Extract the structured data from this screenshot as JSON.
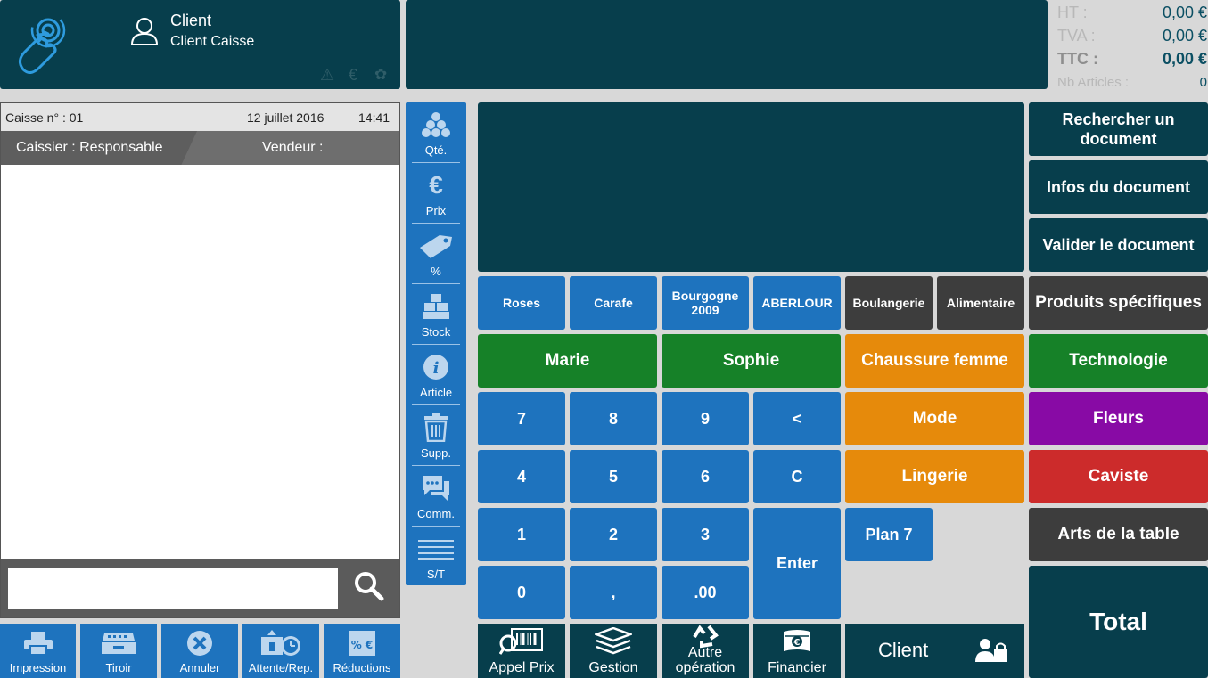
{
  "header": {
    "client_title": "Client",
    "client_name": "Client Caisse"
  },
  "totals": {
    "ht_label": "HT :",
    "ht_value": "0,00 €",
    "tva_label": "TVA  :",
    "tva_value": "0,00 €",
    "ttc_label": "TTC :",
    "ttc_value": "0,00 €",
    "nb_label": "Nb Articles :",
    "nb_value": "0"
  },
  "ticket": {
    "caisse": "Caisse n° : 01",
    "date": "12 juillet 2016",
    "time": "14:41",
    "caissier": "Caissier : Responsable",
    "vendeur": "Vendeur :",
    "search_value": ""
  },
  "side_tools": [
    {
      "label": "Qté.",
      "icon": "quantity-icon"
    },
    {
      "label": "Prix",
      "icon": "euro-icon"
    },
    {
      "label": "%",
      "icon": "tag-icon"
    },
    {
      "label": "Stock",
      "icon": "boxes-icon"
    },
    {
      "label": "Article",
      "icon": "info-icon"
    },
    {
      "label": "Supp.",
      "icon": "trash-icon"
    },
    {
      "label": "Comm.",
      "icon": "chat-icon"
    },
    {
      "label": "S/T",
      "icon": "lines-icon"
    }
  ],
  "quick": {
    "roses": "Roses",
    "carafe": "Carafe",
    "bourgogne": "Bourgogne 2009",
    "aberlour": "ABERLOUR",
    "boulangerie": "Boulangerie",
    "alimentaire": "Alimentaire",
    "marie": "Marie",
    "sophie": "Sophie",
    "chaussure": "Chaussure femme",
    "mode": "Mode",
    "lingerie": "Lingerie",
    "plan7": "Plan 7"
  },
  "keypad": {
    "k7": "7",
    "k8": "8",
    "k9": "9",
    "back": "<",
    "k4": "4",
    "k5": "5",
    "k6": "6",
    "clear": "C",
    "k1": "1",
    "k2": "2",
    "k3": "3",
    "enter": "Enter",
    "k0": "0",
    "comma": ",",
    "dot00": ".00"
  },
  "right": {
    "rechercher": "Rechercher un document",
    "infos": "Infos du document",
    "valider": "Valider le document",
    "produits": "Produits spécifiques",
    "technologie": "Technologie",
    "fleurs": "Fleurs",
    "caviste": "Caviste",
    "arts": "Arts de la table",
    "total": "Total"
  },
  "bottom_left": [
    {
      "label": "Impression",
      "icon": "printer-icon"
    },
    {
      "label": "Tiroir",
      "icon": "drawer-icon"
    },
    {
      "label": "Annuler",
      "icon": "cancel-icon"
    },
    {
      "label": "Attente/Rep.",
      "icon": "hold-icon"
    },
    {
      "label": "Réductions",
      "icon": "discount-icon"
    }
  ],
  "bottom_tools": {
    "appel_prix": "Appel Prix",
    "gestion": "Gestion",
    "autre": "Autre opération",
    "financier": "Financier",
    "client": "Client"
  },
  "colors": {
    "dark_teal": "#073e4c",
    "blue": "#1e73be",
    "green": "#168128",
    "orange": "#e68a0b",
    "purple": "#880aa5",
    "red": "#cc2b2b",
    "dark_grey": "#3d3d3d"
  }
}
